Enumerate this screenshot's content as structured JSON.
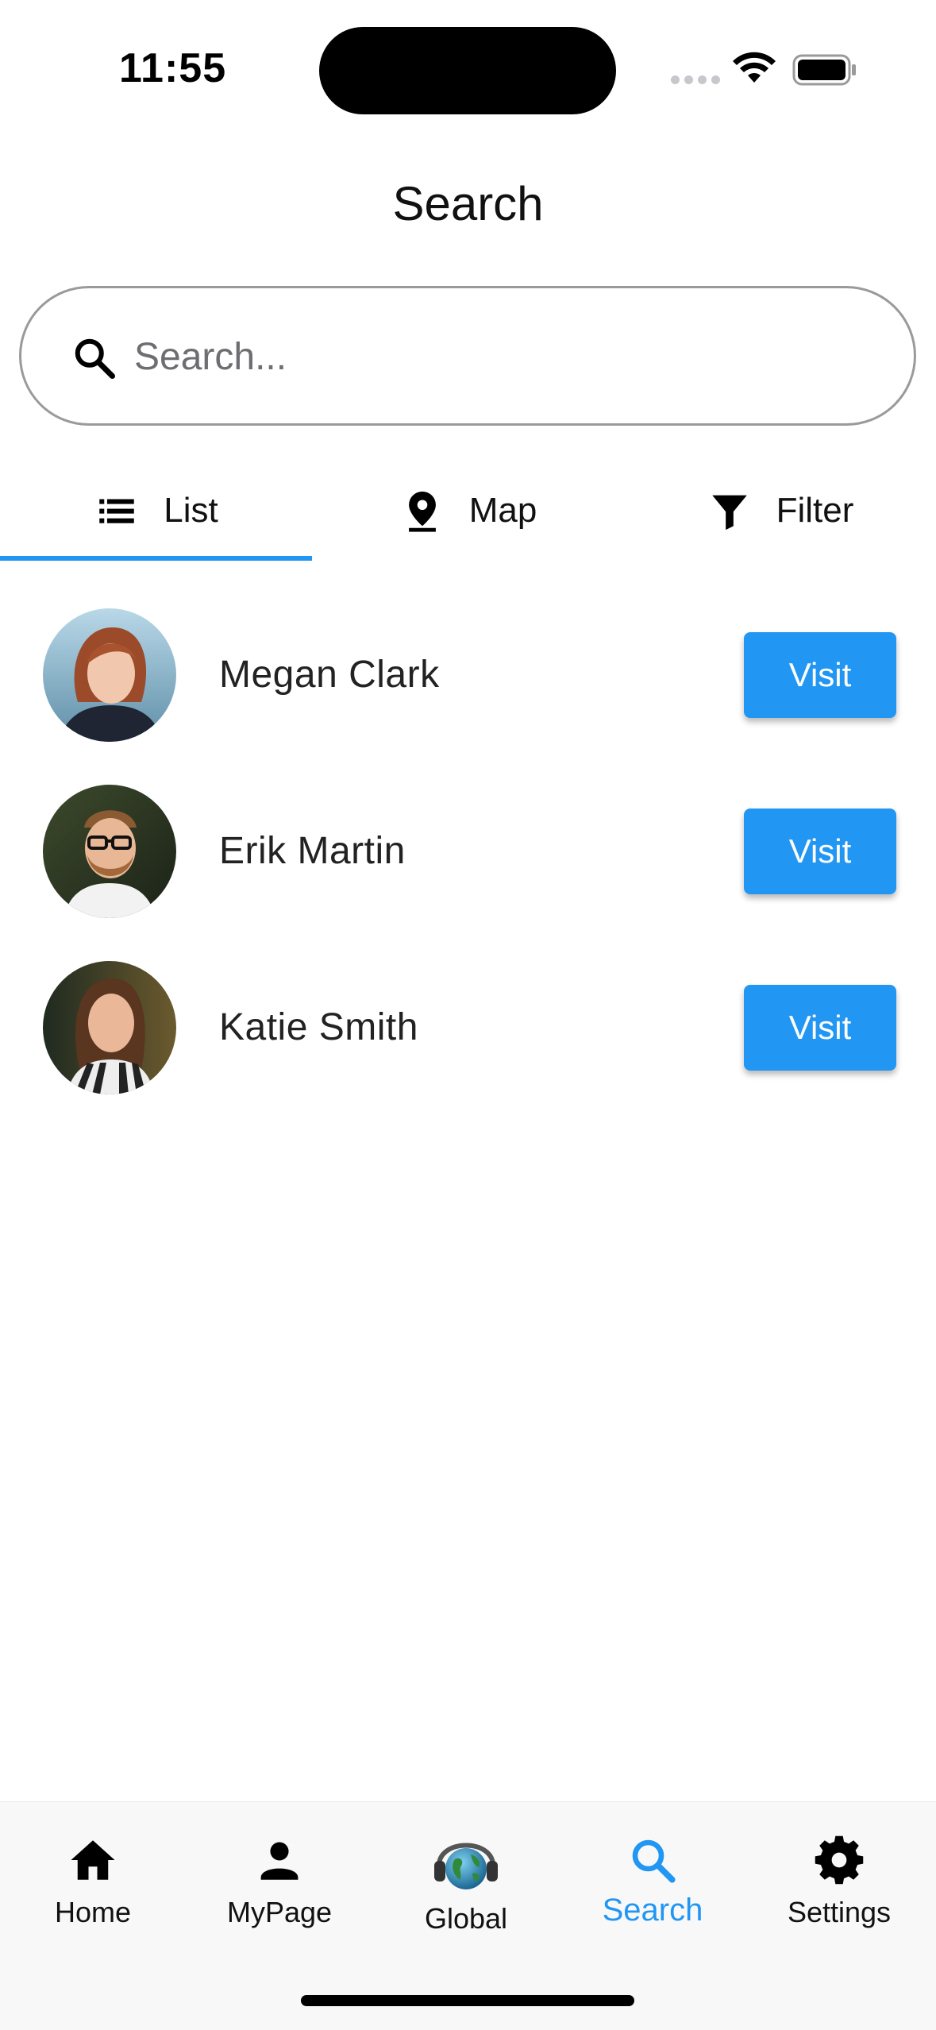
{
  "status_bar": {
    "time": "11:55"
  },
  "header": {
    "title": "Search"
  },
  "search": {
    "placeholder": "Search...",
    "value": ""
  },
  "tabs": [
    {
      "label": "List",
      "icon": "list-icon",
      "active": true
    },
    {
      "label": "Map",
      "icon": "map-pin-icon",
      "active": false
    },
    {
      "label": "Filter",
      "icon": "filter-icon",
      "active": false
    }
  ],
  "results": [
    {
      "name": "Megan Clark",
      "button": "Visit"
    },
    {
      "name": "Erik Martin",
      "button": "Visit"
    },
    {
      "name": "Katie Smith",
      "button": "Visit"
    }
  ],
  "bottom_nav": [
    {
      "label": "Home",
      "icon": "home-icon",
      "active": false
    },
    {
      "label": "MyPage",
      "icon": "person-icon",
      "active": false
    },
    {
      "label": "Global",
      "icon": "globe-headphones-icon",
      "active": false
    },
    {
      "label": "Search",
      "icon": "search-icon",
      "active": true
    },
    {
      "label": "Settings",
      "icon": "gear-icon",
      "active": false
    }
  ],
  "colors": {
    "accent": "#2196f3",
    "text": "#111111",
    "nav_background": "#f8f8f8"
  }
}
